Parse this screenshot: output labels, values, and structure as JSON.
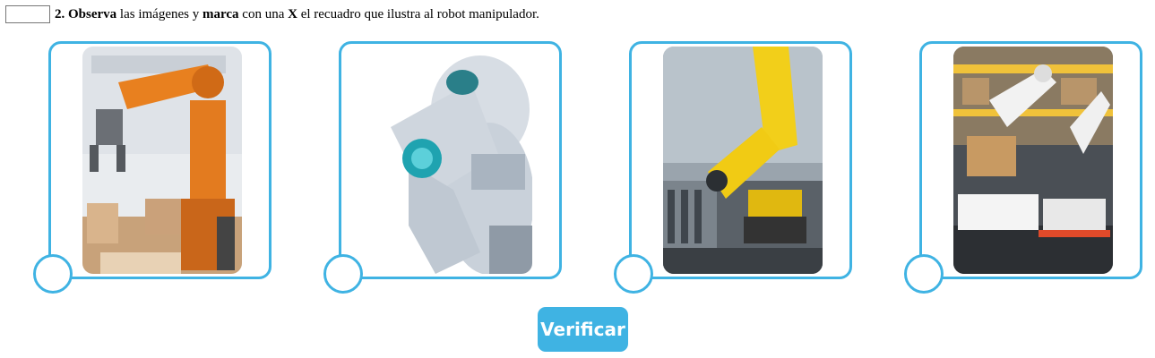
{
  "question": {
    "number": "2.",
    "observa": "Observa",
    "text1": "las imágenes y",
    "marca": "marca",
    "text2": "con una",
    "mark": "X",
    "text3": "el recuadro que ilustra al robot manipulador."
  },
  "options": [
    {
      "image": "orange-industrial-robot-arm-image"
    },
    {
      "image": "humanoid-robot-thinking-image"
    },
    {
      "image": "yellow-industrial-robot-arm-image"
    },
    {
      "image": "white-warehouse-robot-arms-image"
    }
  ],
  "verify_button": {
    "label": "Verificar"
  },
  "colors": {
    "accent": "#3fb3e3",
    "button_text": "#ffffff"
  }
}
